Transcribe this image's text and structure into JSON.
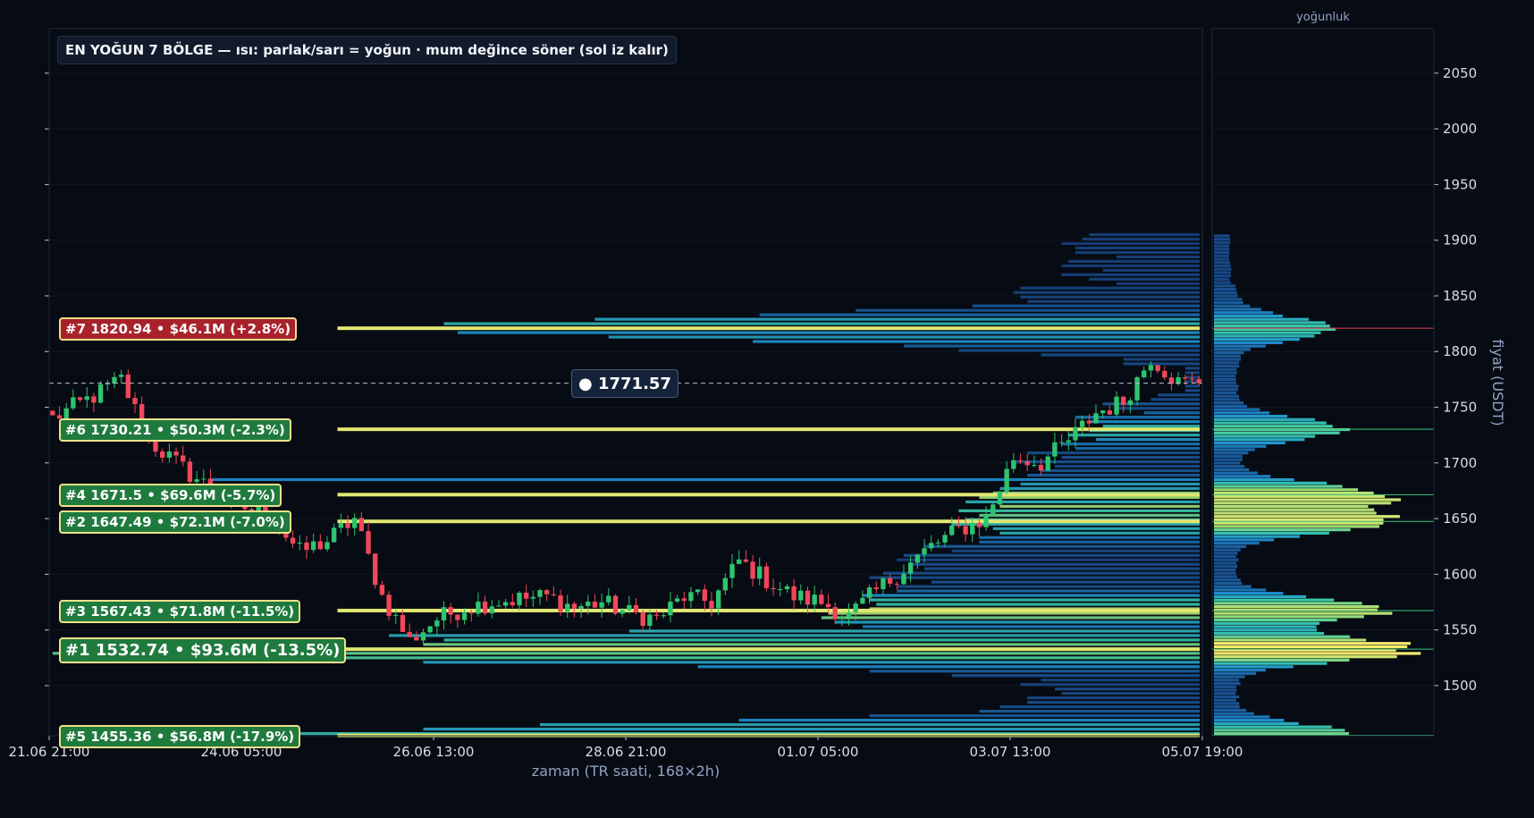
{
  "title": "EN YOĞUN 7 BÖLGE — ısı: parlak/sarı = yoğun · mum değince söner (sol iz kalır)",
  "current_price_label": "● 1771.57",
  "zone_labels": [
    {
      "text": "#7  1820.94  •  $46.1M  (+2.8%)",
      "price": 1820.94,
      "rank": 7,
      "bg": "#a8222c"
    },
    {
      "text": "#6  1730.21  •  $50.3M  (-2.3%)",
      "price": 1730.21,
      "rank": 6,
      "bg": "#1f7a3e"
    },
    {
      "text": "#4  1671.5  •  $69.6M  (-5.7%)",
      "price": 1671.5,
      "rank": 4,
      "bg": "#1f7a3e"
    },
    {
      "text": "#2  1647.49  •  $72.1M  (-7.0%)",
      "price": 1647.49,
      "rank": 2,
      "bg": "#1f7a3e"
    },
    {
      "text": "#3  1567.43  •  $71.8M  (-11.5%)",
      "price": 1567.43,
      "rank": 3,
      "bg": "#1f7a3e"
    },
    {
      "text": "#1  1532.74  •  $93.6M  (-13.5%)",
      "price": 1532.74,
      "rank": 1,
      "bg": "#1f7a3e"
    },
    {
      "text": "#5  1455.36  •  $56.8M  (-17.9%)",
      "price": 1455.36,
      "rank": 5,
      "bg": "#1f7a3e"
    }
  ],
  "colors": {
    "background": "#070b13",
    "bull": "#2ec46f",
    "bear": "#f0475a",
    "grid": "#101826",
    "axis_text": "#d8dde6",
    "axis_label": "#93a3c4",
    "heat_low": "#1a3a7a",
    "heat_mid": "#1fa0d8",
    "heat_high": "#f6e85e"
  },
  "chart_data": {
    "type": "candlestick-heatmap",
    "xlabel": "zaman (TR saati, 168×2h)",
    "ylabel": "fiyat (USDT)",
    "profile_title": "yoğunluk",
    "x_ticks": [
      "21.06 21:00",
      "24.06 05:00",
      "26.06 13:00",
      "28.06 21:00",
      "01.07 05:00",
      "03.07 13:00",
      "05.07 19:00"
    ],
    "y_ticks": [
      1500,
      1550,
      1600,
      1650,
      1700,
      1750,
      1800,
      1850,
      1900,
      1950,
      2000,
      2050
    ],
    "ylim": [
      1455,
      2090
    ],
    "current_price": 1771.57,
    "candle_count": 168,
    "close_anchors": [
      [
        0,
        1740
      ],
      [
        6,
        1760
      ],
      [
        10,
        1775
      ],
      [
        14,
        1720
      ],
      [
        20,
        1690
      ],
      [
        26,
        1665
      ],
      [
        32,
        1650
      ],
      [
        36,
        1620
      ],
      [
        40,
        1630
      ],
      [
        44,
        1650
      ],
      [
        48,
        1580
      ],
      [
        52,
        1540
      ],
      [
        56,
        1560
      ],
      [
        60,
        1570
      ],
      [
        64,
        1575
      ],
      [
        68,
        1578
      ],
      [
        72,
        1580
      ],
      [
        76,
        1570
      ],
      [
        80,
        1575
      ],
      [
        84,
        1565
      ],
      [
        88,
        1560
      ],
      [
        92,
        1580
      ],
      [
        96,
        1575
      ],
      [
        100,
        1612
      ],
      [
        104,
        1595
      ],
      [
        108,
        1580
      ],
      [
        112,
        1575
      ],
      [
        116,
        1562
      ],
      [
        120,
        1585
      ],
      [
        124,
        1605
      ],
      [
        128,
        1625
      ],
      [
        132,
        1640
      ],
      [
        136,
        1650
      ],
      [
        140,
        1705
      ],
      [
        144,
        1700
      ],
      [
        148,
        1720
      ],
      [
        152,
        1745
      ],
      [
        156,
        1755
      ],
      [
        160,
        1795
      ],
      [
        164,
        1772
      ],
      [
        167,
        1771.57
      ]
    ],
    "dense_levels": [
      {
        "price": 1455.36,
        "rank": 5,
        "volume_musd": 56.8
      },
      {
        "price": 1532.74,
        "rank": 1,
        "volume_musd": 93.6
      },
      {
        "price": 1567.43,
        "rank": 3,
        "volume_musd": 71.8
      },
      {
        "price": 1647.49,
        "rank": 2,
        "volume_musd": 72.1
      },
      {
        "price": 1671.5,
        "rank": 4,
        "volume_musd": 69.6
      },
      {
        "price": 1730.21,
        "rank": 6,
        "volume_musd": 50.3
      },
      {
        "price": 1820.94,
        "rank": 7,
        "volume_musd": 46.1
      }
    ]
  }
}
